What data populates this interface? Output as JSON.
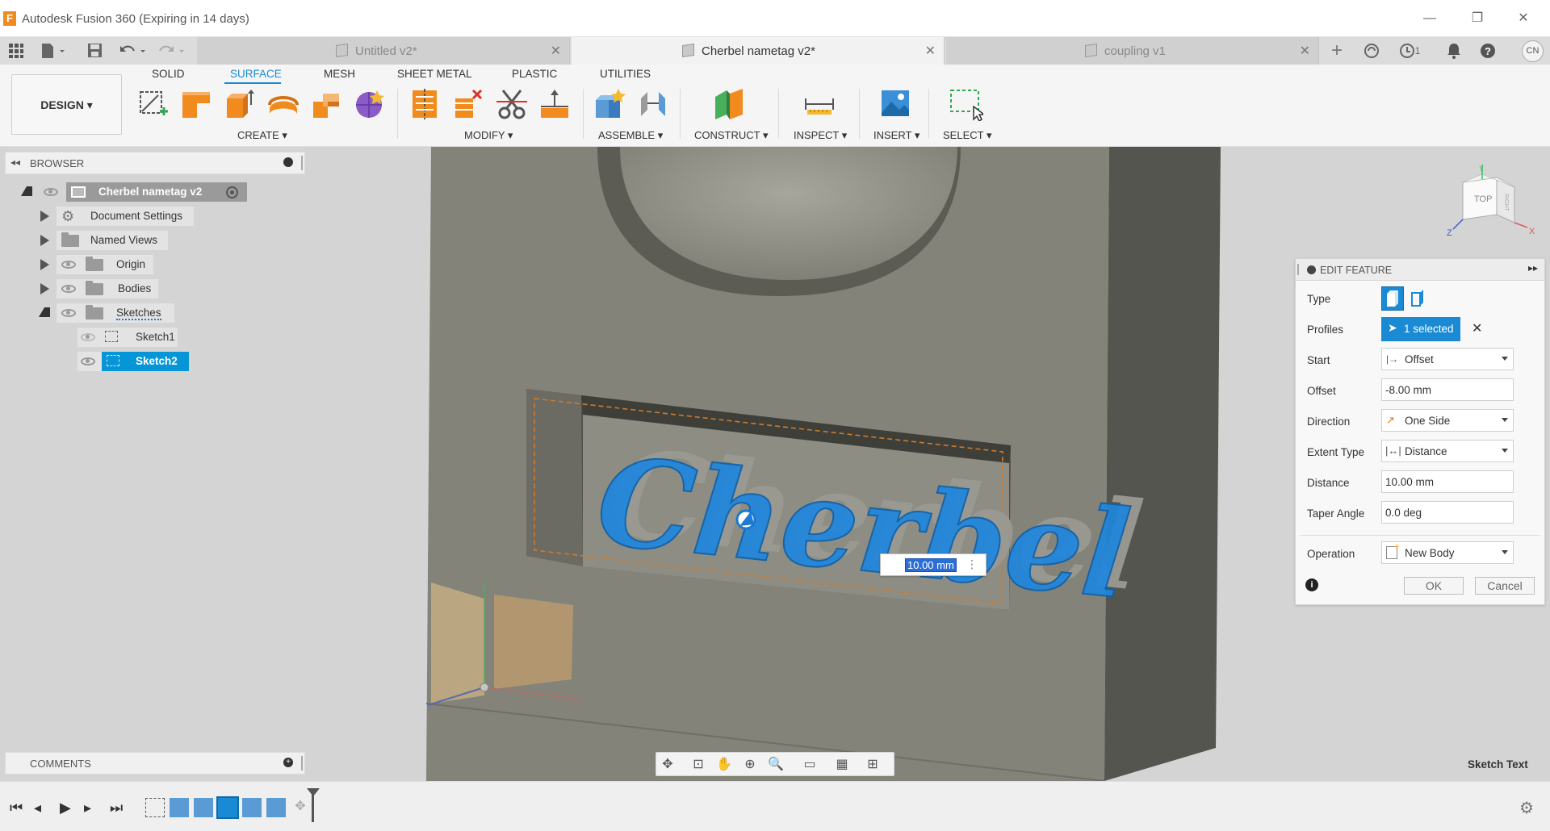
{
  "window": {
    "title": "Autodesk Fusion 360 (Expiring in 14 days)",
    "logo_letter": "F",
    "minimize": "—",
    "restore": "❐",
    "close": "✕"
  },
  "tabs": [
    {
      "label": "Untitled v2*",
      "active": false
    },
    {
      "label": "Cherbel nametag v2*",
      "active": true
    },
    {
      "label": "coupling v1",
      "active": false
    }
  ],
  "tab_close": "✕",
  "top_right": {
    "add": "+",
    "jobs_count": "1",
    "avatar": "CN"
  },
  "toolbar": {
    "workspace": "DESIGN ▾",
    "workspace_tabs": [
      "SOLID",
      "SURFACE",
      "MESH",
      "SHEET METAL",
      "PLASTIC",
      "UTILITIES"
    ],
    "active_tab": "SURFACE",
    "groups": {
      "create": "CREATE ▾",
      "modify": "MODIFY ▾",
      "assemble": "ASSEMBLE ▾",
      "construct": "CONSTRUCT ▾",
      "inspect": "INSPECT ▾",
      "insert": "INSERT ▾",
      "select": "SELECT ▾"
    }
  },
  "browser": {
    "title": "BROWSER",
    "root": "Cherbel nametag v2",
    "items": [
      {
        "label": "Document Settings"
      },
      {
        "label": "Named Views"
      },
      {
        "label": "Origin"
      },
      {
        "label": "Bodies"
      },
      {
        "label": "Sketches"
      },
      {
        "label": "Sketch1"
      },
      {
        "label": "Sketch2"
      }
    ]
  },
  "comments": {
    "title": "COMMENTS"
  },
  "edit_feature": {
    "title": "EDIT FEATURE",
    "rows": {
      "type": "Type",
      "profiles": "Profiles",
      "profiles_value": "1 selected",
      "start": "Start",
      "start_value": "Offset",
      "offset": "Offset",
      "offset_value": "-8.00 mm",
      "direction": "Direction",
      "direction_value": "One Side",
      "extent_type": "Extent Type",
      "extent_type_value": "Distance",
      "distance": "Distance",
      "distance_value": "10.00 mm",
      "taper_angle": "Taper Angle",
      "taper_angle_value": "0.0 deg",
      "operation": "Operation",
      "operation_value": "New Body"
    },
    "ok": "OK",
    "cancel": "Cancel"
  },
  "viewport": {
    "nametag_text": "Cherbel",
    "distance_input": "10.00 mm",
    "viewcube_face": "TOP",
    "viewcube_side": "RIGHT",
    "axis_x": "X",
    "axis_y": "Y",
    "axis_z": "Z"
  },
  "status": {
    "sketch_text": "Sketch Text"
  },
  "colors": {
    "accent": "#1a8ad4",
    "selection": "#0696d7",
    "body": "#7f7f76"
  }
}
